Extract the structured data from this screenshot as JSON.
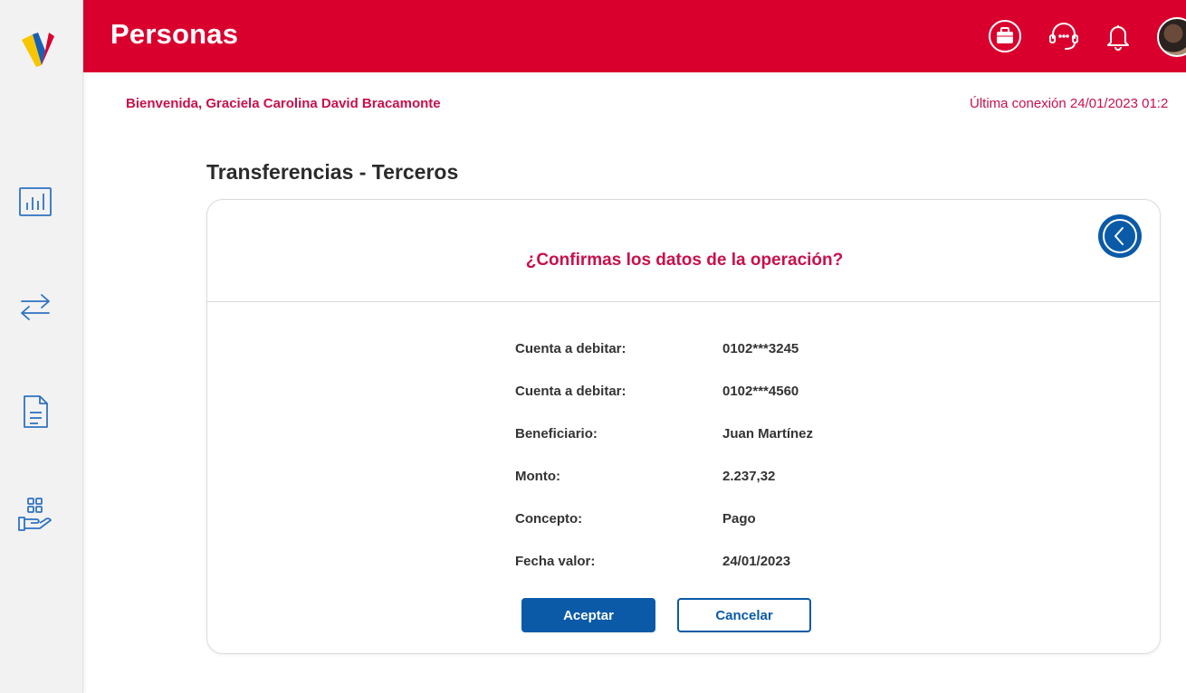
{
  "header": {
    "title": "Personas",
    "icons": [
      "briefcase-icon",
      "support-agent-icon",
      "bell-icon",
      "user-avatar"
    ]
  },
  "sidebar": {
    "items": [
      {
        "icon": "bar-chart-icon"
      },
      {
        "icon": "transfer-arrows-icon"
      },
      {
        "icon": "document-icon"
      },
      {
        "icon": "services-hand-icon"
      }
    ]
  },
  "welcome": "Bienvenida, Graciela Carolina David Bracamonte",
  "last_connection": "Última conexión 24/01/2023 01:2",
  "section_title": "Transferencias - Terceros",
  "confirm": {
    "question": "¿Confirmas los datos de la operación?",
    "rows": [
      {
        "label": "Cuenta a debitar:",
        "value": "0102***3245"
      },
      {
        "label": "Cuenta a debitar:",
        "value": "0102***4560"
      },
      {
        "label": "Beneficiario:",
        "value": "Juan Martínez"
      },
      {
        "label": "Monto:",
        "value": "2.237,32"
      },
      {
        "label": "Concepto:",
        "value": "Pago"
      },
      {
        "label": "Fecha valor:",
        "value": "24/01/2023"
      }
    ],
    "accept_label": "Aceptar",
    "cancel_label": "Cancelar"
  },
  "colors": {
    "brand_red": "#d9002e",
    "accent_pink": "#c8104a",
    "primary_blue": "#0a5aa8"
  }
}
